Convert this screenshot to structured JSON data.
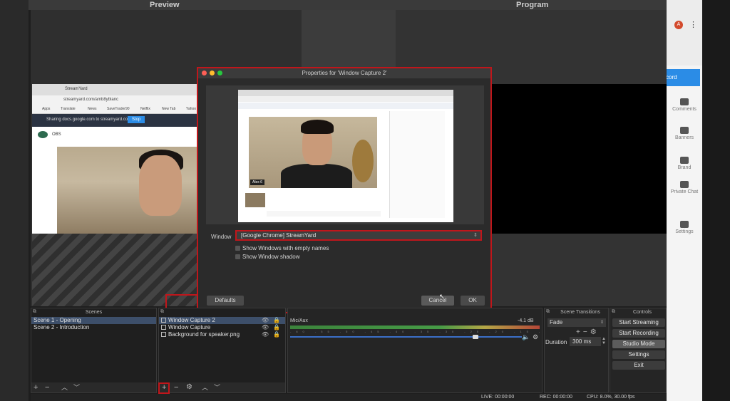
{
  "studio": {
    "preview_title": "Preview",
    "program_title": "Program"
  },
  "browser_right": {
    "avatar_letter": "A",
    "record_label": "cord",
    "side_items": [
      "Comments",
      "Banners",
      "Brand",
      "Private Chat",
      "Settings"
    ]
  },
  "captured_browser": {
    "tab_title": "StreamYard",
    "url": "streamyard.com/amb8yblanc",
    "bookmarks": [
      "Apps",
      "Translate",
      "News",
      "SaveTrader90",
      "Netflix",
      "New Tab",
      "Yahoo"
    ],
    "share_text": "Sharing docs.google.com to streamyard.com",
    "stop_label": "Stop",
    "studio_name": "OBS"
  },
  "dialog": {
    "title": "Properties for 'Window Capture 2'",
    "inner_name_chip": "Alex 6",
    "window_label": "Window",
    "window_value": "[Google Chrome] StreamYard",
    "checkbox_empty_names": "Show Windows with empty names",
    "checkbox_shadow": "Show Window shadow",
    "defaults_label": "Defaults",
    "cancel_label": "Cancel",
    "ok_label": "OK"
  },
  "scenes": {
    "title": "Scenes",
    "items": [
      "Scene 1 - Opening",
      "Scene 2 - Introduction"
    ]
  },
  "sources": {
    "items": [
      "Window Capture 2",
      "Window Capture",
      "Background for speaker.png"
    ]
  },
  "mixer": {
    "name": "Mic/Aux",
    "db": "-4.1 dB",
    "ticks": "-60 -55 -50 -45 -40 -35 -30 -25 -20 -15 -10 -5 0",
    "volume_fraction": 0.8
  },
  "transitions": {
    "title": "Scene Transitions",
    "selected": "Fade",
    "duration_label": "Duration",
    "duration_value": "300 ms"
  },
  "controls": {
    "title": "Controls",
    "start_streaming": "Start Streaming",
    "start_recording": "Start Recording",
    "studio_mode": "Studio Mode",
    "settings": "Settings",
    "exit": "Exit"
  },
  "status": {
    "live": "LIVE: 00:00:00",
    "rec": "REC: 00:00:00",
    "cpu": "CPU: 8.0%, 30.00 fps"
  },
  "colors": {
    "highlight_red": "#c0161b",
    "accent_blue": "#2b8ce6",
    "selection_blue": "#3d4f6a"
  }
}
